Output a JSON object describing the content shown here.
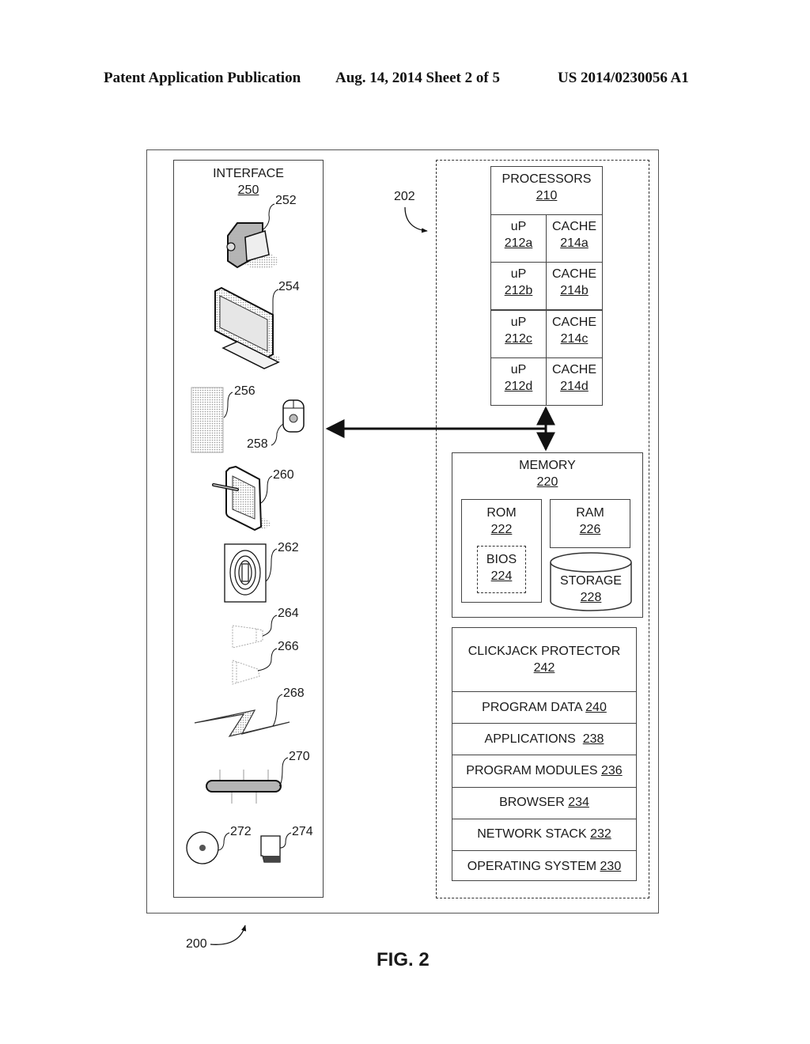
{
  "header": {
    "publication": "Patent Application Publication",
    "date_sheet": "Aug. 14, 2014  Sheet 2 of 5",
    "patent_number": "US 2014/0230056 A1"
  },
  "figure": {
    "caption": "FIG. 2",
    "system_ref": "200",
    "computing_device_ref": "202"
  },
  "interface": {
    "title": "INTERFACE",
    "number": "250",
    "devices": [
      {
        "ref": "252",
        "icon": "video-camera-icon"
      },
      {
        "ref": "254",
        "icon": "monitor-icon"
      },
      {
        "ref": "256",
        "icon": "keyboard-icon"
      },
      {
        "ref": "258",
        "icon": "mouse-icon"
      },
      {
        "ref": "260",
        "icon": "tablet-stylus-icon"
      },
      {
        "ref": "262",
        "icon": "fingerprint-reader-icon"
      },
      {
        "ref": "264",
        "icon": "speaker-icon"
      },
      {
        "ref": "266",
        "icon": "microphone-icon"
      },
      {
        "ref": "268",
        "icon": "wireless-signal-icon"
      },
      {
        "ref": "270",
        "icon": "network-bus-icon"
      },
      {
        "ref": "272",
        "icon": "optical-disc-icon"
      },
      {
        "ref": "274",
        "icon": "memory-card-icon"
      }
    ]
  },
  "processors": {
    "title": "PROCESSORS",
    "number": "210",
    "rows": [
      {
        "up_label": "uP",
        "up_num": "212a",
        "cache_label": "CACHE",
        "cache_num": "214a"
      },
      {
        "up_label": "uP",
        "up_num": "212b",
        "cache_label": "CACHE",
        "cache_num": "214b"
      },
      {
        "up_label": "uP",
        "up_num": "212c",
        "cache_label": "CACHE",
        "cache_num": "214c"
      },
      {
        "up_label": "uP",
        "up_num": "212d",
        "cache_label": "CACHE",
        "cache_num": "214d"
      }
    ]
  },
  "memory": {
    "title": "MEMORY",
    "number": "220",
    "rom": {
      "label": "ROM",
      "number": "222"
    },
    "bios": {
      "label": "BIOS",
      "number": "224"
    },
    "ram": {
      "label": "RAM",
      "number": "226"
    },
    "storage": {
      "label": "STORAGE",
      "number": "228"
    }
  },
  "software_stack": [
    {
      "label": "CLICKJACK PROTECTOR",
      "number": "242"
    },
    {
      "label": "PROGRAM DATA ",
      "number": "240"
    },
    {
      "label": "APPLICATIONS  ",
      "number": "238"
    },
    {
      "label": "PROGRAM MODULES ",
      "number": "236"
    },
    {
      "label": "BROWSER ",
      "number": "234"
    },
    {
      "label": "NETWORK STACK ",
      "number": "232"
    },
    {
      "label": "OPERATING SYSTEM ",
      "number": "230"
    }
  ]
}
